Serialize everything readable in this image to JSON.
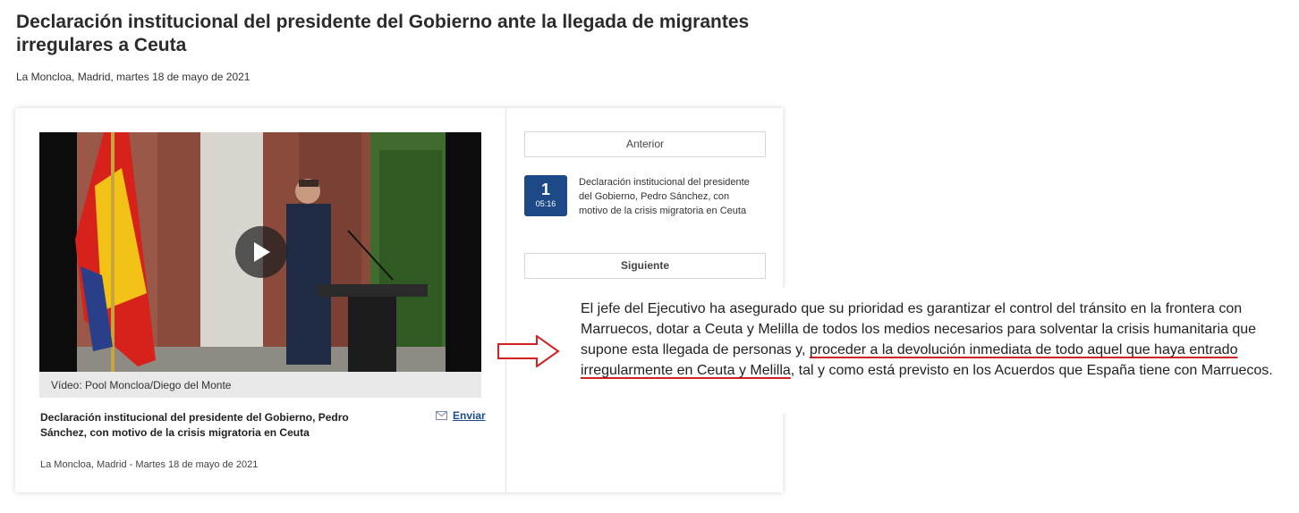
{
  "page": {
    "title": "Declaración institucional del presidente del Gobierno ante la llegada de migrantes irregulares a Ceuta",
    "location_date": "La Moncloa, Madrid, martes 18 de mayo de 2021"
  },
  "video": {
    "caption": "Vídeo: Pool Moncloa/Diego del Monte",
    "title": "Declaración institucional del presidente del Gobierno, Pedro Sánchez, con motivo de la crisis migratoria en Ceuta",
    "send_label": "Enviar",
    "date": "La Moncloa, Madrid - Martes 18 de mayo de 2021",
    "icons": {
      "play": "play-icon",
      "send": "envelope-icon"
    }
  },
  "playlist": {
    "prev_label": "Anterior",
    "next_label": "Siguiente",
    "items": [
      {
        "number": "1",
        "duration": "05:16",
        "title": "Declaración institucional del presidente del Gobierno, Pedro Sánchez, con motivo de la crisis migratoria en Ceuta"
      }
    ]
  },
  "callout": {
    "text_before": "El jefe del Ejecutivo ha asegurado que su prioridad es garantizar el control del tránsito en la frontera con Marruecos, dotar a Ceuta y Melilla de todos los medios necesarios para solventar la crisis humanitaria que supone esta llegada de personas y, ",
    "text_highlight": "proceder a la devolución inmediata de todo aquel que haya entrado irregularmente en Ceuta y Melilla",
    "text_after": ", tal y como está previsto en los Acuerdos que España tiene con Marruecos.",
    "highlight_color": "#d32020",
    "arrow_color": "#d32020"
  },
  "colors": {
    "badge": "#1d4a86",
    "link": "#1c4d8c"
  }
}
